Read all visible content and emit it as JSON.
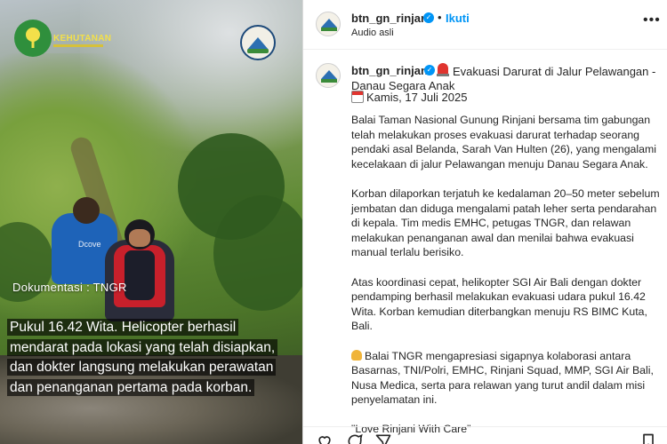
{
  "media": {
    "logo_left_text": "KEHUTANAN",
    "documentation_label": "Dokumentasi : TNGR",
    "shirt_text": "Dcove",
    "caption_lines": [
      "Pukul 16.42 Wita. Helicopter berhasil",
      "mendarat pada lokasi yang telah disiapkan,",
      "dan dokter langsung melakukan perawatan",
      "dan penanganan pertama pada korban."
    ]
  },
  "header": {
    "username": "btn_gn_rinjani",
    "separator": "•",
    "follow_label": "Ikuti",
    "audio_label": "Audio asli",
    "more_icon": "more-horizontal-icon"
  },
  "caption": {
    "username": "btn_gn_rinjani",
    "title_line1": "Evakuasi Darurat di Jalur Pelawangan -",
    "title_line2": "Danau Segara Anak",
    "date": "Kamis, 17 Juli 2025",
    "paragraphs": [
      "Balai Taman Nasional Gunung Rinjani bersama tim gabungan telah melakukan proses evakuasi darurat terhadap seorang pendaki asal Belanda, Sarah Van Hulten (26), yang mengalami kecelakaan di jalur Pelawangan menuju Danau Segara Anak.",
      "Korban dilaporkan terjatuh ke kedalaman 20–50 meter sebelum jembatan dan diduga mengalami patah leher serta pendarahan di kepala. Tim medis EMHC, petugas TNGR, dan relawan melakukan penanganan awal dan menilai bahwa evakuasi manual terlalu berisiko.",
      "Atas koordinasi cepat, helikopter SGI Air Bali dengan dokter pendamping berhasil melakukan evakuasi udara pukul 16.42 Wita. Korban kemudian diterbangkan menuju RS BIMC Kuta, Bali.",
      "Balai TNGR mengapresiasi sigapnya kolaborasi antara Basarnas, TNI/Polri, EMHC, Rinjani Squad, MMP, SGI Air Bali, Nusa Medica, serta para relawan yang turut andil dalam misi penyelamatan ini.",
      "\"Love Rinjani With Care\""
    ]
  },
  "icons": [
    "heart-icon",
    "comment-icon",
    "share-icon",
    "bookmark-icon",
    "verified-icon",
    "siren-icon",
    "calendar-icon",
    "pray-icon"
  ],
  "colors": {
    "accent": "#0095f6",
    "text": "#262626",
    "siren": "#e0342f"
  }
}
